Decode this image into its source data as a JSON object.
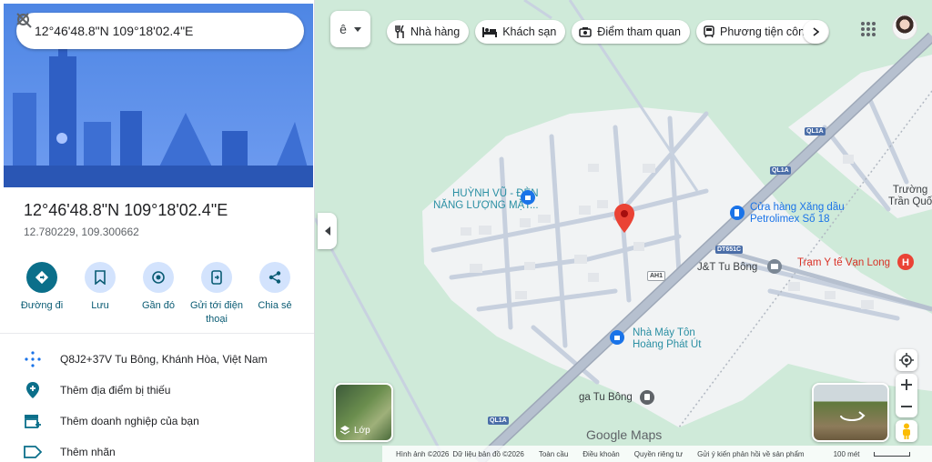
{
  "search": {
    "value": "12°46'48.8\"N 109°18'02.4\"E"
  },
  "place": {
    "title": "12°46'48.8\"N 109°18'02.4\"E",
    "subtitle": "12.780229, 109.300662"
  },
  "actions": [
    {
      "label": "Đường đi",
      "icon": "directions-icon"
    },
    {
      "label": "Lưu",
      "icon": "bookmark-icon"
    },
    {
      "label": "Gần đó",
      "icon": "nearby-icon"
    },
    {
      "label": "Gửi tới điện thoại",
      "icon": "send-to-phone-icon"
    },
    {
      "label": "Chia sẻ",
      "icon": "share-icon"
    }
  ],
  "info": [
    {
      "text": "Q8J2+37V Tu Bông, Khánh Hòa, Việt Nam",
      "icon": "plus-code-icon"
    },
    {
      "text": "Thêm địa điểm bị thiếu",
      "icon": "add-place-icon"
    },
    {
      "text": "Thêm doanh nghiệp của bạn",
      "icon": "add-business-icon"
    },
    {
      "text": "Thêm nhãn",
      "icon": "label-icon"
    }
  ],
  "language_button": "ê",
  "chips": [
    {
      "label": "Nhà hàng",
      "icon": "restaurant-icon"
    },
    {
      "label": "Khách sạn",
      "icon": "hotel-icon"
    },
    {
      "label": "Điểm tham quan",
      "icon": "camera-icon"
    },
    {
      "label": "Phương tiện công c",
      "icon": "transit-icon"
    }
  ],
  "map_labels": {
    "poi_solar": [
      "HUỲNH VŨ - ĐÈN",
      "NĂNG LƯỢNG MẶT..."
    ],
    "poi_gas": [
      "Cửa hàng Xăng dầu",
      "Petrolimex Số 18"
    ],
    "poi_jt": "J&T Tu Bông",
    "poi_clinic": "Trạm Y tế Vạn Long",
    "poi_factory": [
      "Nhà Máy Tôn",
      "Hoàng Phát Út"
    ],
    "poi_school": [
      "Trường",
      "Trần Quố"
    ],
    "station": "ga Tu Bông",
    "shields": [
      "QL1A",
      "QL1A",
      "DT651C",
      "AH1",
      "QL1A"
    ]
  },
  "layers_label": "Lớp",
  "branding": "Google Maps",
  "attribution": {
    "imagery": "Hình ảnh ©2026",
    "map_data": "Dữ liệu bản đồ ©2026",
    "global": "Toàn cầu",
    "terms": "Điều khoản",
    "privacy": "Quyền riêng tư",
    "feedback": "Gửi ý kiến phản hồi về sản phẩm",
    "scale": "100 mét"
  },
  "colors": {
    "map_green": "#cfead9",
    "road_gray": "#a9b3c4",
    "blue_accent": "#1a73e8",
    "pin_red": "#ea4335"
  }
}
